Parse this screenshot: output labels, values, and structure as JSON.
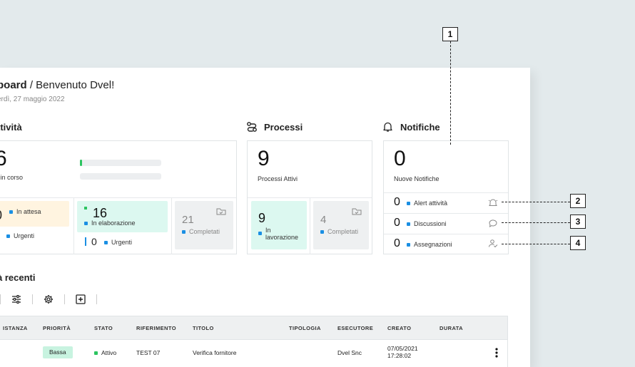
{
  "header": {
    "title_bold": "board",
    "title_rest": " / Benvenuto Dvel!",
    "date": "erdì, 27 maggio 2022"
  },
  "attivita": {
    "section_label": "ttività",
    "total": "6",
    "total_label": "à in corso",
    "progress": 0.03,
    "attesa": {
      "count": "0",
      "label": "In attesa",
      "urgent_label": "Urgenti"
    },
    "elaborazione": {
      "count": "16",
      "label": "In elaborazione",
      "urgent_count": "0",
      "urgent_label": "Urgenti"
    },
    "completati": {
      "count": "21",
      "label": "Completati"
    }
  },
  "processi": {
    "section_label": "Processi",
    "total": "9",
    "total_label": "Processi Attivi",
    "lavorazione": {
      "count": "9",
      "label": "In lavorazione"
    },
    "completati": {
      "count": "4",
      "label": "Completati"
    }
  },
  "notifiche": {
    "section_label": "Notifiche",
    "total": "0",
    "total_label": "Nuove Notifiche",
    "items": [
      {
        "count": "0",
        "label": "Alert attività",
        "icon": "bell-icon"
      },
      {
        "count": "0",
        "label": "Discussioni",
        "icon": "chat-icon"
      },
      {
        "count": "0",
        "label": "Assegnazioni",
        "icon": "user-check-icon"
      }
    ]
  },
  "recenti": {
    "section_label": "à recenti",
    "columns": [
      "ISTANZA",
      "PRIORITÀ",
      "STATO",
      "RIFERIMENTO",
      "TITOLO",
      "TIPOLOGIA",
      "ESECUTORE",
      "CREATO",
      "DURATA"
    ],
    "rows": [
      {
        "istanza": "",
        "priorita": "Bassa",
        "stato": "Attivo",
        "riferimento": "TEST 07",
        "titolo": "Verifica fornitore",
        "tipologia": "",
        "esecutore": "Dvel Snc",
        "creato_date": "07/05/2021",
        "creato_time": "17:28:02",
        "durata": ""
      }
    ]
  },
  "callouts": [
    "1",
    "2",
    "3",
    "4"
  ],
  "colors": {
    "accent": "#1a8fe3",
    "green": "#2cc460",
    "attesa_bg": "#fff4e0",
    "elaborazione_bg": "#dcf8f0",
    "gray_tile": "#eef0f1",
    "priority_bg": "#c8f3e0"
  }
}
